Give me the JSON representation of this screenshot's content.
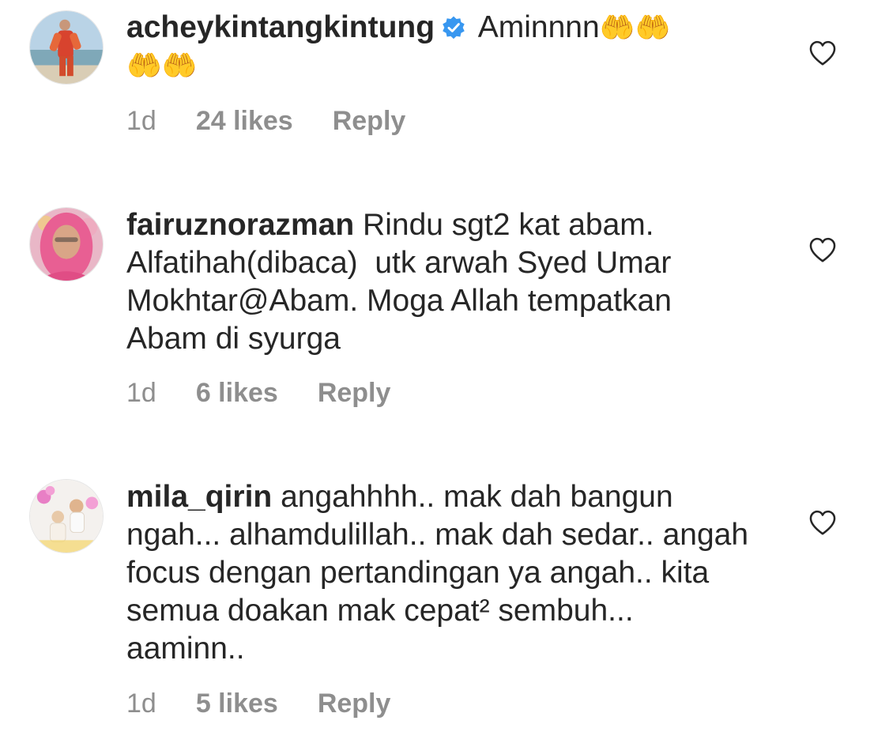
{
  "comments": [
    {
      "username": "acheykintangkintung",
      "verified": true,
      "text": " Aminnnn",
      "emoji_line1": "🤲🤲",
      "emoji_line2": "🤲🤲",
      "time": "1d",
      "likes": "24 likes",
      "reply": "Reply"
    },
    {
      "username": "fairuznorazman",
      "verified": false,
      "text": " Rindu sgt2 kat abam. Alfatihah(dibaca)  utk arwah Syed Umar Mokhtar@Abam. Moga Allah tempatkan Abam di syurga",
      "time": "1d",
      "likes": "6 likes",
      "reply": "Reply"
    },
    {
      "username": "mila_qirin",
      "verified": false,
      "text": " angahhhh.. mak dah bangun ngah... alhamdulillah.. mak dah sedar.. angah focus dengan pertandingan ya angah.. kita semua doakan mak cepat² sembuh... aaminn..",
      "time": "1d",
      "likes": "5 likes",
      "reply": "Reply"
    }
  ],
  "colors": {
    "text": "#262626",
    "meta": "#8e8e8e",
    "verified": "#3897f0"
  },
  "icons": {
    "like": "heart-outline-icon",
    "verified": "verified-badge-icon"
  }
}
